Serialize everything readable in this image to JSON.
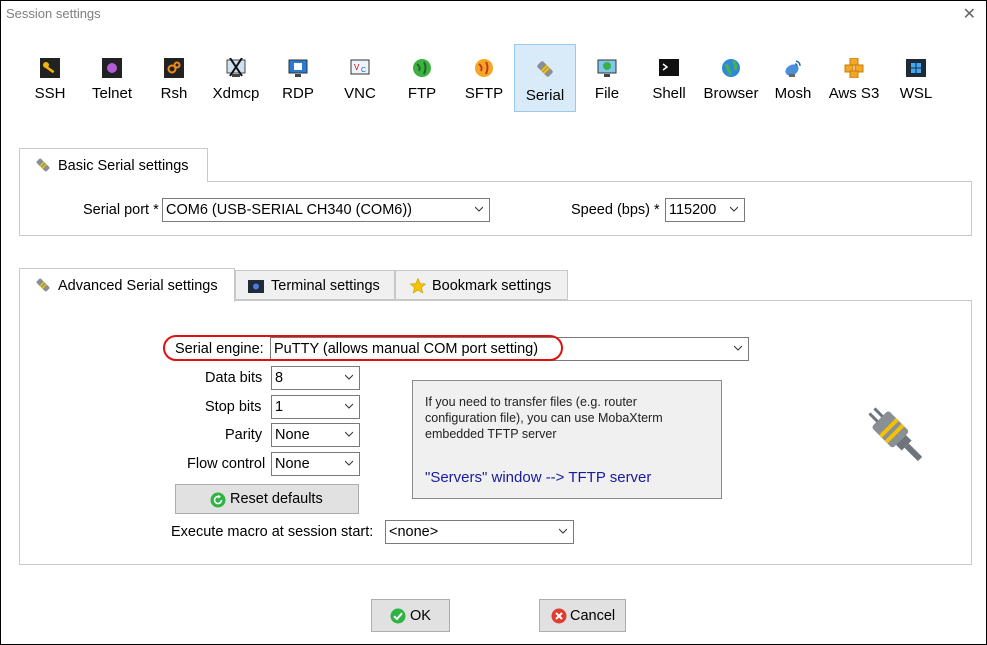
{
  "window": {
    "title": "Session settings",
    "close_symbol": "✕"
  },
  "protocols": [
    {
      "label": "SSH",
      "icon": "key-icon"
    },
    {
      "label": "Telnet",
      "icon": "telnet-icon"
    },
    {
      "label": "Rsh",
      "icon": "rsh-icon"
    },
    {
      "label": "Xdmcp",
      "icon": "xdmcp-icon"
    },
    {
      "label": "RDP",
      "icon": "rdp-monitor-icon"
    },
    {
      "label": "VNC",
      "icon": "vnc-icon"
    },
    {
      "label": "FTP",
      "icon": "ftp-globe-icon"
    },
    {
      "label": "SFTP",
      "icon": "sftp-globe-icon"
    },
    {
      "label": "Serial",
      "icon": "serial-plug-icon",
      "selected": true
    },
    {
      "label": "File",
      "icon": "file-monitor-icon"
    },
    {
      "label": "Shell",
      "icon": "shell-terminal-icon"
    },
    {
      "label": "Browser",
      "icon": "browser-globe-icon"
    },
    {
      "label": "Mosh",
      "icon": "mosh-satellite-icon"
    },
    {
      "label": "Aws S3",
      "icon": "aws-cubes-icon"
    },
    {
      "label": "WSL",
      "icon": "windows-icon"
    }
  ],
  "basic": {
    "tab_label": "Basic Serial settings",
    "serial_port_label": "Serial port *",
    "serial_port_value": "COM6  (USB-SERIAL CH340 (COM6))",
    "speed_label": "Speed (bps) *",
    "speed_value": "115200"
  },
  "tabs": {
    "advanced": "Advanced Serial settings",
    "terminal": "Terminal settings",
    "bookmark": "Bookmark settings"
  },
  "advanced": {
    "serial_engine_label": "Serial engine:",
    "serial_engine_value": "PuTTY    (allows manual COM port setting)",
    "data_bits_label": "Data bits",
    "data_bits_value": "8",
    "stop_bits_label": "Stop bits",
    "stop_bits_value": "1",
    "parity_label": "Parity",
    "parity_value": "None",
    "flow_control_label": "Flow control",
    "flow_control_value": "None",
    "reset_label": "Reset defaults",
    "macro_label": "Execute macro at session start:",
    "macro_value": "<none>",
    "info_text": "If you need to transfer files (e.g. router configuration file), you can use MobaXterm embedded TFTP server",
    "info_link": "\"Servers\" window  -->  TFTP server"
  },
  "buttons": {
    "ok": "OK",
    "cancel": "Cancel"
  },
  "colors": {
    "selected_bg": "#d9ebf9",
    "highlight_ring": "#e01010",
    "link": "#1a1a9e",
    "ok_green": "#2fb344",
    "cancel_red": "#e03c31"
  }
}
